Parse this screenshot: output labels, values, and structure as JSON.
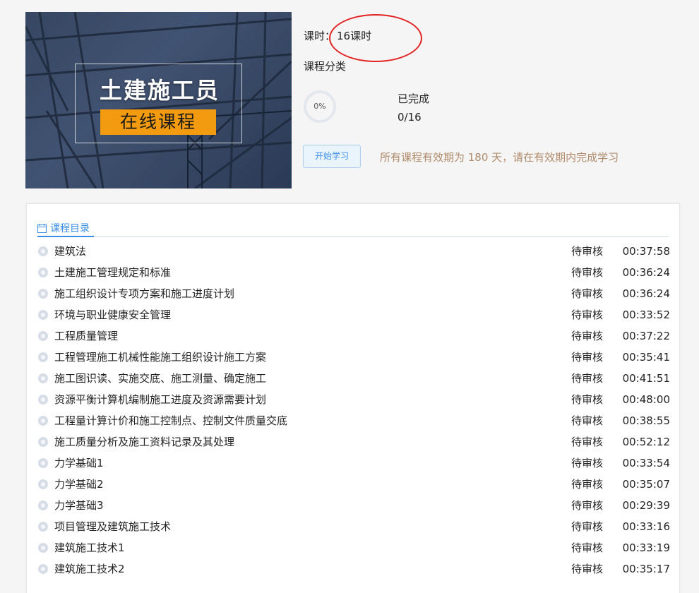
{
  "banner": {
    "title": "土建施工员",
    "subtitle": "在线课程"
  },
  "course": {
    "hours_label": "课时：",
    "hours_value": "16课时",
    "category_label": "课程分类",
    "progress_percent_text": "0%",
    "progress_fraction": 0,
    "completed_label": "已完成",
    "completed_count": "0/16",
    "start_button": "开始学习",
    "validity_note": "所有课程有效期为 180 天，请在有效期内完成学习"
  },
  "catalog": {
    "tab_label": "课程目录",
    "lessons": [
      {
        "title": "建筑法",
        "status": "待审核",
        "duration": "00:37:58"
      },
      {
        "title": "土建施工管理规定和标准",
        "status": "待审核",
        "duration": "00:36:24"
      },
      {
        "title": "施工组织设计专项方案和施工进度计划",
        "status": "待审核",
        "duration": "00:36:24"
      },
      {
        "title": "环境与职业健康安全管理",
        "status": "待审核",
        "duration": "00:33:52"
      },
      {
        "title": "工程质量管理",
        "status": "待审核",
        "duration": "00:37:22"
      },
      {
        "title": "工程管理施工机械性能施工组织设计施工方案",
        "status": "待审核",
        "duration": "00:35:41"
      },
      {
        "title": "施工图识读、实施交底、施工测量、确定施工",
        "status": "待审核",
        "duration": "00:41:51"
      },
      {
        "title": "资源平衡计算机编制施工进度及资源需要计划",
        "status": "待审核",
        "duration": "00:48:00"
      },
      {
        "title": "工程量计算计价和施工控制点、控制文件质量交底",
        "status": "待审核",
        "duration": "00:38:55"
      },
      {
        "title": "施工质量分析及施工资料记录及其处理",
        "status": "待审核",
        "duration": "00:52:12"
      },
      {
        "title": "力学基础1",
        "status": "待审核",
        "duration": "00:33:54"
      },
      {
        "title": "力学基础2",
        "status": "待审核",
        "duration": "00:35:07"
      },
      {
        "title": "力学基础3",
        "status": "待审核",
        "duration": "00:29:39"
      },
      {
        "title": "项目管理及建筑施工技术",
        "status": "待审核",
        "duration": "00:33:16"
      },
      {
        "title": "建筑施工技术1",
        "status": "待审核",
        "duration": "00:33:19"
      },
      {
        "title": "建筑施工技术2",
        "status": "待审核",
        "duration": "00:35:17"
      }
    ]
  },
  "colors": {
    "accent": "#3a8ee6",
    "banner_highlight": "#f39b10",
    "annotation": "#e32222",
    "validity_text": "#b08a6a"
  }
}
